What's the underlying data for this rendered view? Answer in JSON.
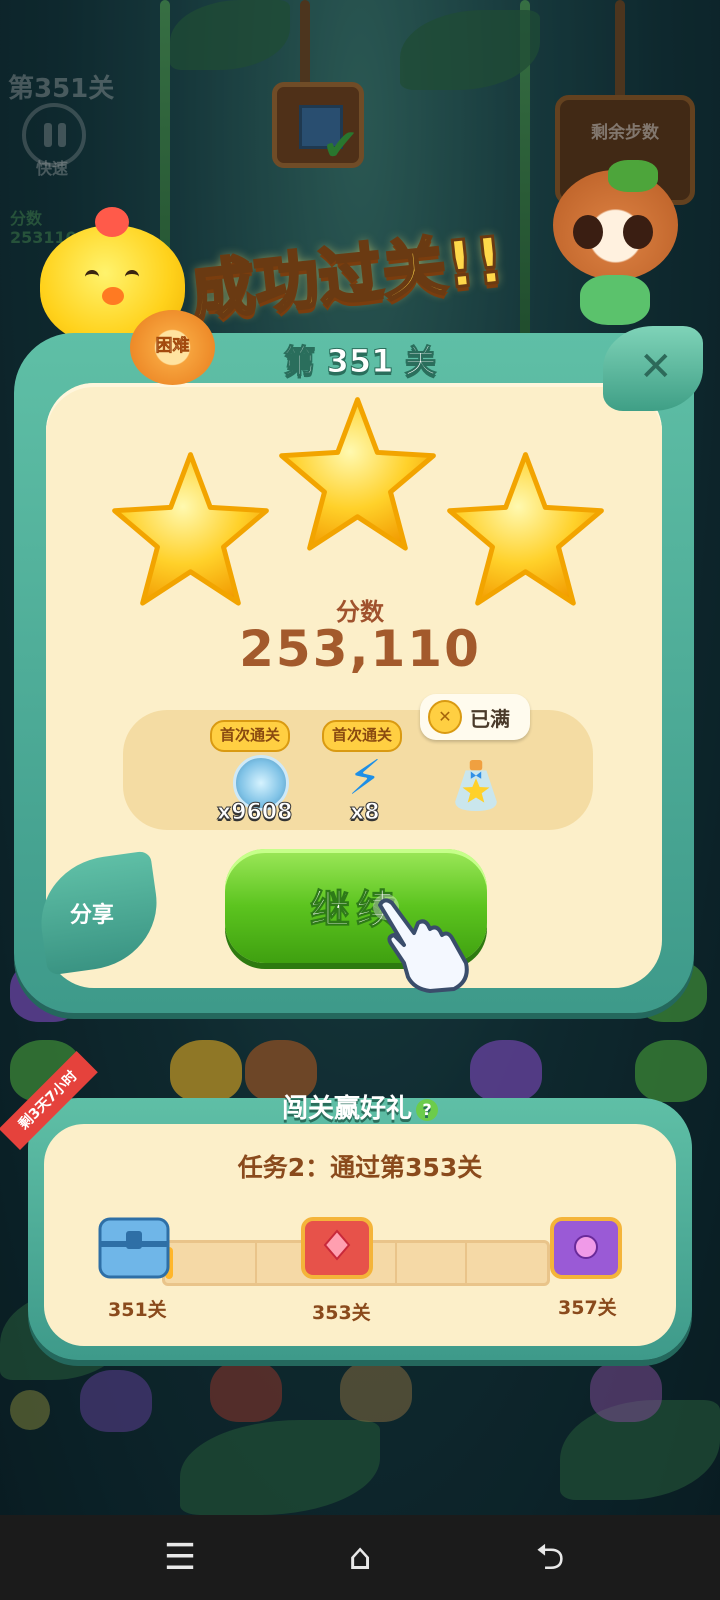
{
  "hud": {
    "level": "第351关",
    "pause_label": "快速",
    "score_label": "分数",
    "score_value": "253110",
    "moves_label": "剩余步数"
  },
  "result": {
    "title": "成功过关!!",
    "level_title": "第 351 关",
    "difficulty": "困难",
    "stars_earned": 3,
    "stars_total": 3,
    "score_label": "分数",
    "score": "253,110",
    "rewards": [
      {
        "tag": "首次通关",
        "item": "coin-icon",
        "qty": "x9608"
      },
      {
        "tag": "首次通关",
        "item": "lightning-icon",
        "qty": "x8"
      },
      {
        "status": "已满",
        "item": "star-potion-icon"
      }
    ],
    "share_label": "分享",
    "continue_label": "继续"
  },
  "event": {
    "title": "闯关赢好礼",
    "help": "?",
    "ribbon": "剩3天7小时",
    "mission": "任务2：通过第353关",
    "progress_fraction": 0.02,
    "milestones": [
      {
        "label": "351关",
        "chest": "blue-chest-icon"
      },
      {
        "label": "353关",
        "chest": "red-chest-icon"
      },
      {
        "label": "357关",
        "chest": "purple-chest-icon"
      }
    ]
  },
  "navbar": {
    "menu": "☰",
    "home": "⌂",
    "back": "⮌"
  },
  "colors": {
    "accent_green": "#5cc41f",
    "panel_teal": "#4fae98",
    "cream": "#fcefc9",
    "score_brown": "#a35a2c"
  }
}
